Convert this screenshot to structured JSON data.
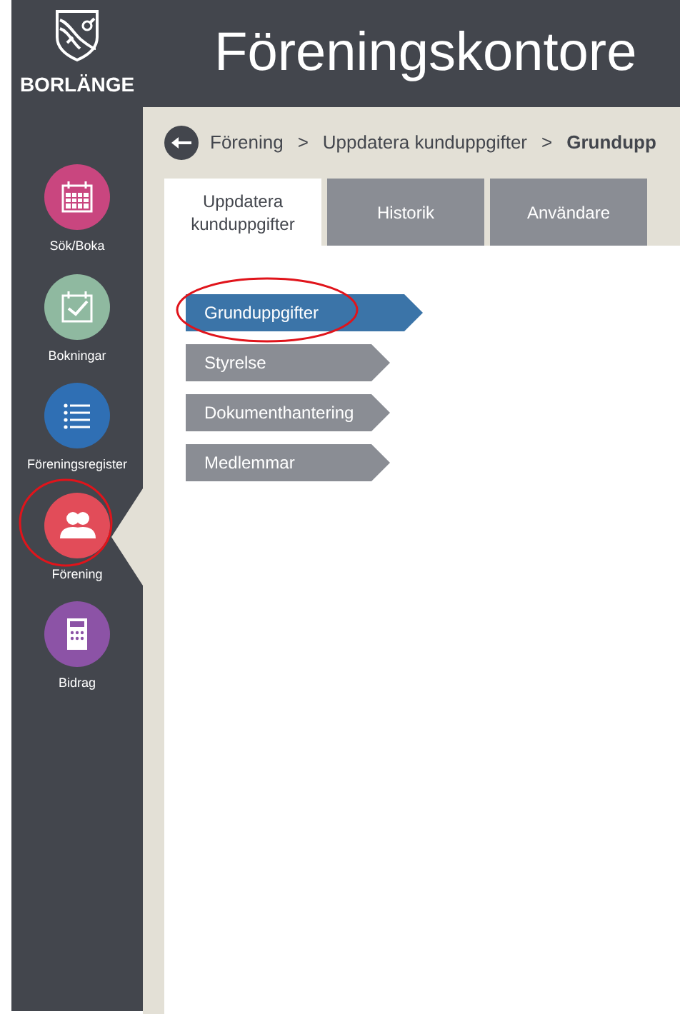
{
  "logo": {
    "text": "BORLÄNGE"
  },
  "header": {
    "title": "Föreningskontore"
  },
  "sidebar": {
    "items": [
      {
        "label": "Sök/Boka",
        "kind": "calendar",
        "color": "#c9467f",
        "selected": false,
        "circled": false
      },
      {
        "label": "Bokningar",
        "kind": "check",
        "color": "#8fb9a0",
        "selected": false,
        "circled": false
      },
      {
        "label": "Föreningsregister",
        "kind": "list",
        "color": "#2f6fb4",
        "selected": false,
        "circled": false
      },
      {
        "label": "Förening",
        "kind": "people",
        "color": "#e24c59",
        "selected": true,
        "circled": true
      },
      {
        "label": "Bidrag",
        "kind": "calculator",
        "color": "#8c53a6",
        "selected": false,
        "circled": false
      }
    ]
  },
  "breadcrumb": {
    "items": [
      {
        "label": "Förening",
        "current": false
      },
      {
        "label": "Uppdatera kunduppgifter",
        "current": false
      },
      {
        "label": "Grundupp",
        "current": true
      }
    ],
    "separator": ">"
  },
  "tabs": [
    {
      "label": "Uppdatera kunduppgifter",
      "selected": true
    },
    {
      "label": "Historik",
      "selected": false
    },
    {
      "label": "Användare",
      "selected": false
    }
  ],
  "submenu": [
    {
      "label": "Grunduppgifter",
      "selected": true,
      "circled": true
    },
    {
      "label": "Styrelse",
      "selected": false,
      "circled": false
    },
    {
      "label": "Dokumenthantering",
      "selected": false,
      "circled": false
    },
    {
      "label": "Medlemmar",
      "selected": false,
      "circled": false
    }
  ]
}
